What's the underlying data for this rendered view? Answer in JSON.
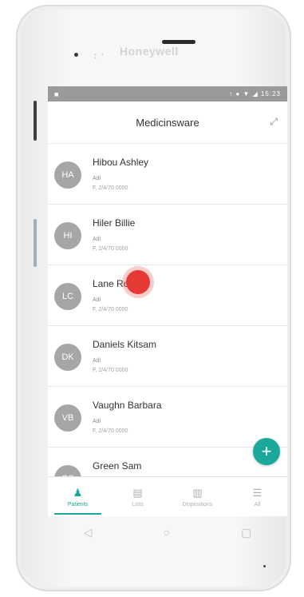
{
  "device": {
    "brand": "Honeywell",
    "sensor": "• • •"
  },
  "statusbar": {
    "left_icon": "■",
    "right": "↑ ● ▼ ◢ 15:23"
  },
  "header": {
    "title": "Medicinsware",
    "expand_icon": "⤢"
  },
  "patients": [
    {
      "initials": "HA",
      "name": "Hibou Ashley",
      "sub": "Adl",
      "date": "F, 2/4/70 0000"
    },
    {
      "initials": "HI",
      "name": "Hiler Billie",
      "sub": "Adl",
      "date": "F, 2/4/70 0000"
    },
    {
      "initials": "LC",
      "name": "Lane Robins",
      "sub": "Adl",
      "date": "F, 2/4/70 0000"
    },
    {
      "initials": "DK",
      "name": "Daniels Kitsam",
      "sub": "Adl",
      "date": "F, 2/4/70 0000"
    },
    {
      "initials": "VB",
      "name": "Vaughn Barbara",
      "sub": "Adl",
      "date": "F, 2/4/70 0000"
    },
    {
      "initials": "GS",
      "name": "Green Sam",
      "sub": "",
      "date": ""
    }
  ],
  "fab": {
    "label": "+"
  },
  "bottom_nav": [
    {
      "icon": "person-icon",
      "glyph": "♟",
      "label": "Patients"
    },
    {
      "icon": "list-icon",
      "glyph": "▤",
      "label": "Lists"
    },
    {
      "icon": "clipboard-icon",
      "glyph": "▥",
      "label": "Dispositions"
    },
    {
      "icon": "menu-icon",
      "glyph": "☰",
      "label": "All"
    }
  ],
  "system_nav": {
    "back": "◁",
    "home": "○",
    "recent": "▢"
  }
}
